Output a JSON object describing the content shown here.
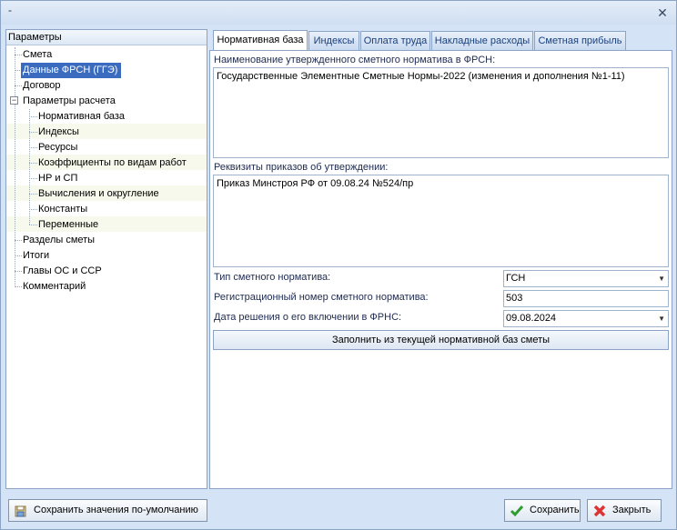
{
  "window": {
    "title": "-",
    "close_symbol": "✕"
  },
  "left_panel": {
    "header": "Параметры",
    "items": [
      {
        "label": "Смета"
      },
      {
        "label": "Данные ФРСН (ГГЭ)"
      },
      {
        "label": "Договор"
      },
      {
        "label": "Параметры расчета"
      },
      {
        "label": "Нормативная база"
      },
      {
        "label": "Индексы"
      },
      {
        "label": "Ресурсы"
      },
      {
        "label": "Коэффициенты по видам работ"
      },
      {
        "label": "НР и СП"
      },
      {
        "label": "Вычисления и округление"
      },
      {
        "label": "Константы"
      },
      {
        "label": "Переменные"
      },
      {
        "label": "Разделы сметы"
      },
      {
        "label": "Итоги"
      },
      {
        "label": "Главы ОС и ССР"
      },
      {
        "label": "Комментарий"
      }
    ],
    "selected_index": 1,
    "expander_symbol": "−"
  },
  "tabs": [
    {
      "label": "Нормативная база"
    },
    {
      "label": "Индексы"
    },
    {
      "label": "Оплата труда"
    },
    {
      "label": "Накладные расходы"
    },
    {
      "label": "Сметная прибыль"
    }
  ],
  "form": {
    "name_label": "Наименование утвержденного сметного норматива в ФРСН:",
    "name_value": "Государственные Элементные Сметные Нормы-2022 (изменения и дополнения №1-11)",
    "orders_label": "Реквизиты приказов об утверждении:",
    "orders_value": "Приказ Минстроя РФ от 09.08.24 №524/пр",
    "type_label": "Тип сметного норматива:",
    "type_value": "ГСН",
    "reg_label": "Регистрационный номер сметного норматива:",
    "reg_value": "503",
    "date_label": "Дата решения о его включении в ФРНС:",
    "date_value": "09.08.2024",
    "fill_button": "Заполнить из текущей нормативной баз сметы"
  },
  "bottom": {
    "save_default": "Сохранить значения по-умолчанию",
    "save": "Сохранить",
    "close": "Закрыть"
  },
  "colors": {
    "selection": "#3a6bbf",
    "save_check": "#2e9d2e",
    "close_x": "#d33"
  }
}
